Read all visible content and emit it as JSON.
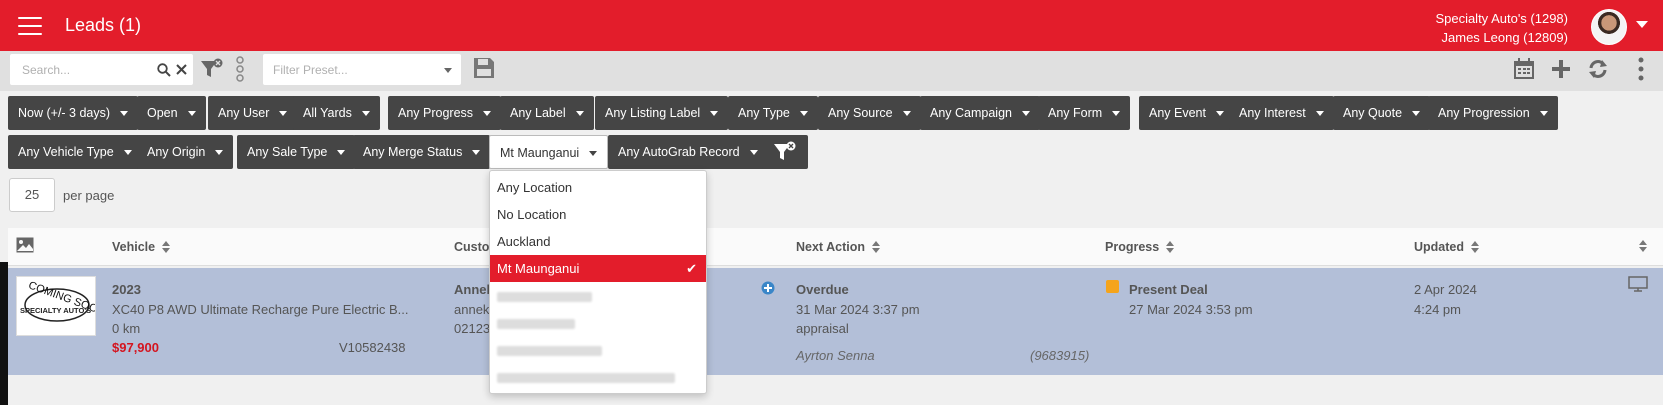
{
  "header": {
    "title": "Leads (1)",
    "account_line1": "Specialty Auto's (1298)",
    "account_line2": "James Leong (12809)",
    "brand_color": "#e31d2b"
  },
  "toolbar": {
    "search_placeholder": "Search...",
    "preset_placeholder": "Filter Preset..."
  },
  "filters": {
    "row1": [
      "Now (+/- 3 days)",
      "Open",
      "Any User",
      "All Yards",
      "Any Progress",
      "Any Label",
      "Any Listing Label",
      "Any Type",
      "Any Source",
      "Any Campaign",
      "Any Form",
      "Any Event",
      "Any Interest",
      "Any Quote",
      "Any Progression"
    ],
    "row2": [
      "Any Vehicle Type",
      "Any Origin",
      "Any Sale Type",
      "Any Merge Status",
      "Mt Maunganui",
      "Any AutoGrab Record"
    ]
  },
  "pagination": {
    "per_page_value": "25",
    "per_page_label": "per page"
  },
  "table": {
    "columns": [
      "Vehicle",
      "Custo",
      "Next Action",
      "Progress",
      "Updated"
    ],
    "row": {
      "thumb_text": "COMING SOON",
      "thumb_brand": "SPECIALTY AUTO'S",
      "year": "2023",
      "model": "XC40 P8 AWD Ultimate Recharge Pure Electric B...",
      "km": "0 km",
      "price": "$97,900",
      "stock": "V10582438",
      "customer_name": "Annek",
      "customer_email": "annek",
      "customer_phone": "02123",
      "next_action_status": "Overdue",
      "next_action_date": "31 Mar 2024 3:37 pm",
      "next_action_type": "appraisal",
      "next_action_user": "Ayrton Senna",
      "next_action_id": "(9683915)",
      "progress_label": "Present Deal",
      "progress_date": "27 Mar 2024 3:53 pm",
      "progress_color": "#f5a41b",
      "updated_date": "2 Apr 2024",
      "updated_time": "4:24 pm"
    },
    "row_color": "#b3bfd8"
  },
  "location_dropdown": {
    "options": [
      "Any Location",
      "No Location",
      "Auckland",
      "Mt Maunganui"
    ],
    "selected": "Mt Maunganui",
    "check": "✔"
  }
}
